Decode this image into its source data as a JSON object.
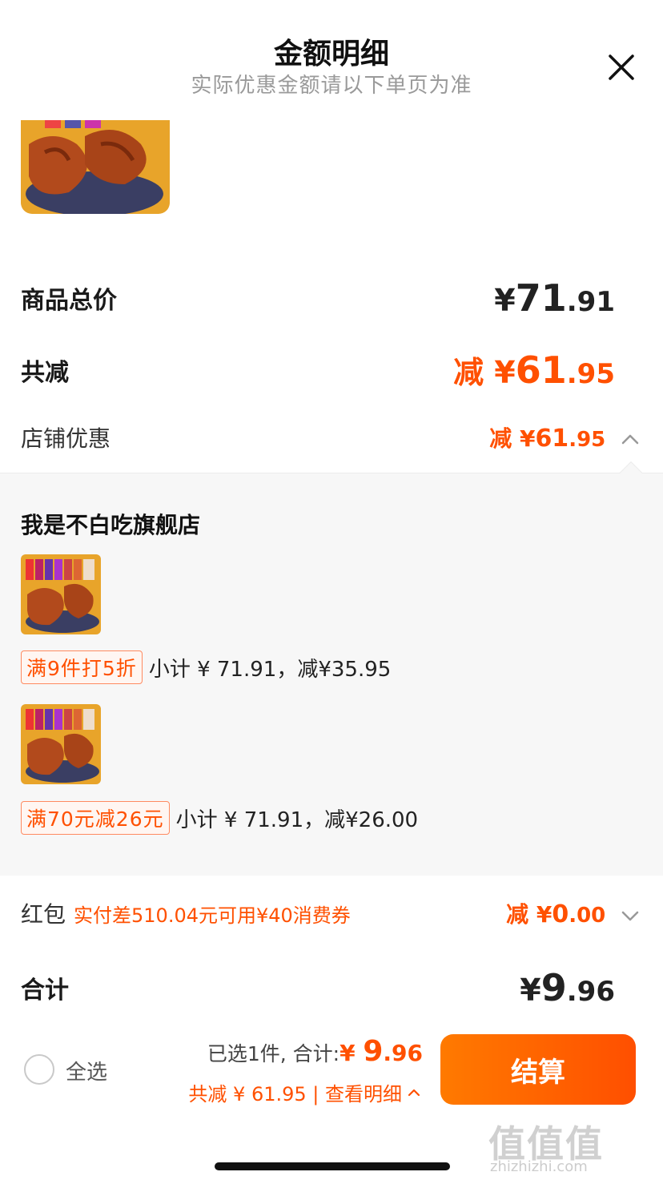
{
  "header": {
    "title": "金额明细",
    "subtitle": "实际优惠金额请以下单页为准",
    "close_icon": "close-icon"
  },
  "summary": {
    "goods_total_label": "商品总价",
    "goods_total_currency": "¥",
    "goods_total_int": "71",
    "goods_total_dec": ".91",
    "total_reduce_label": "共减",
    "total_reduce_prefix": "减 ¥",
    "total_reduce_int": "61",
    "total_reduce_dec": ".95",
    "shop_discount_label": "店铺优惠",
    "shop_discount_prefix": "减 ¥",
    "shop_discount_int": "61",
    "shop_discount_dec": ".95"
  },
  "shop": {
    "name": "我是不白吃旗舰店",
    "promos": [
      {
        "tag": "满9件打5折",
        "text": "小计 ¥ 71.91，减¥35.95"
      },
      {
        "tag": "满70元减26元",
        "text": "小计 ¥ 71.91，减¥26.00"
      }
    ]
  },
  "hongbao": {
    "label": "红包",
    "note": "实付差510.04元可用¥40消费券",
    "prefix": "减 ¥",
    "int": "0",
    "dec": ".00"
  },
  "total": {
    "label": "合计",
    "currency": "¥",
    "int": "9",
    "dec": ".96"
  },
  "bottom": {
    "select_all": "全选",
    "selected_text": "已选1件, 合计:",
    "selected_amount_currency": "¥ ",
    "selected_amount_int": "9",
    "selected_amount_dec": ".96",
    "reduce_text": "共减 ¥ 61.95 | 查看明细",
    "checkout_label": "结算"
  },
  "watermark": {
    "main": "值值值",
    "sub": "zhizhizhi.com"
  },
  "colors": {
    "accent": "#ff5000",
    "accent_gradient_start": "#ff7a00",
    "panel_bg": "#f7f7f7"
  }
}
